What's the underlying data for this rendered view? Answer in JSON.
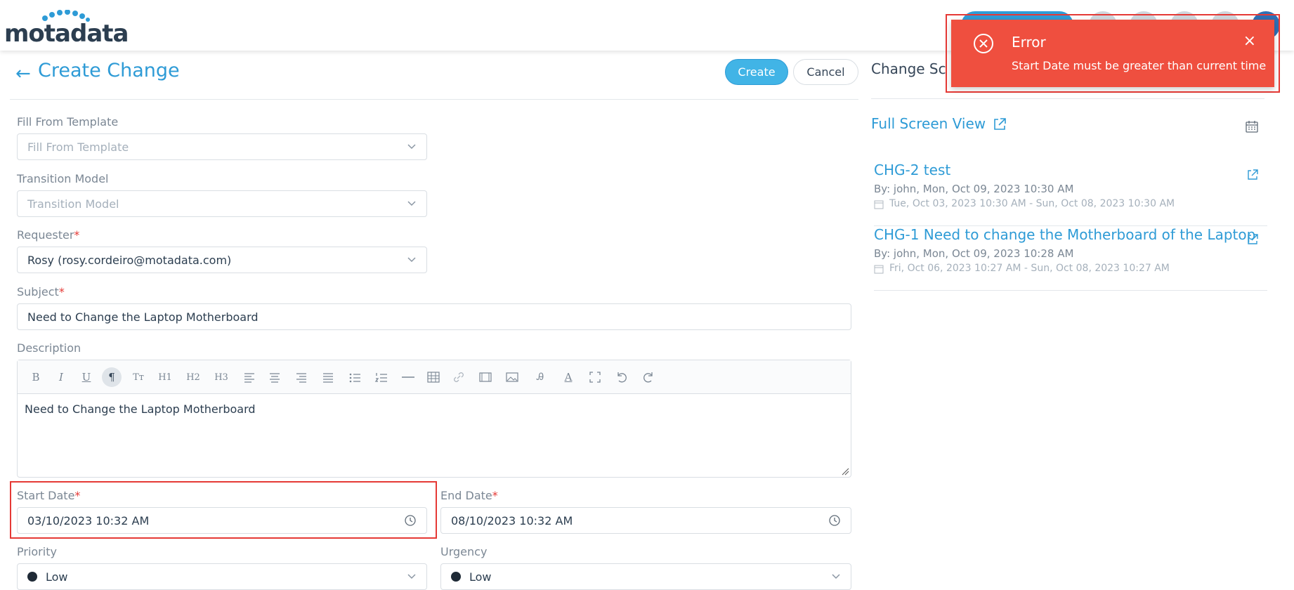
{
  "brand": {
    "logo_text": "motadata"
  },
  "header": {
    "title": "Create Change",
    "create_label": "Create",
    "cancel_label": "Cancel"
  },
  "form": {
    "template": {
      "label": "Fill From Template",
      "placeholder": "Fill From Template"
    },
    "transition_model": {
      "label": "Transition Model",
      "placeholder": "Transition Model"
    },
    "requester": {
      "label": "Requester",
      "required_mark": "*",
      "value": "Rosy (rosy.cordeiro@motadata.com)"
    },
    "subject": {
      "label": "Subject",
      "required_mark": "*",
      "value": "Need to Change the Laptop Motherboard"
    },
    "description": {
      "label": "Description",
      "value": "Need to Change the Laptop Motherboard",
      "toolbar": [
        "B",
        "I",
        "U",
        "¶",
        "Tт",
        "H1",
        "H2",
        "H3"
      ]
    },
    "start_date": {
      "label": "Start Date",
      "required_mark": "*",
      "value": "03/10/2023 10:32 AM"
    },
    "end_date": {
      "label": "End Date",
      "required_mark": "*",
      "value": "08/10/2023 10:32 AM"
    },
    "priority": {
      "label": "Priority",
      "value": "Low"
    },
    "urgency": {
      "label": "Urgency",
      "value": "Low"
    }
  },
  "schedule": {
    "title": "Change Sc",
    "full_screen_label": "Full Screen View",
    "items": [
      {
        "title": "CHG-2 test",
        "by": "By: john, Mon, Oct 09, 2023 10:30 AM",
        "range": "Tue, Oct 03, 2023 10:30 AM - Sun, Oct 08, 2023 10:30 AM"
      },
      {
        "title": "CHG-1 Need to change the Motherboard of the Laptop",
        "by": "By: john, Mon, Oct 09, 2023 10:28 AM",
        "range": "Fri, Oct 06, 2023 10:27 AM - Sun, Oct 08, 2023 10:27 AM"
      }
    ]
  },
  "toast": {
    "title": "Error",
    "message": "Start Date must be greater than current time"
  },
  "colors": {
    "accent": "#2e9bd6",
    "error": "#ef4f3f",
    "highlight": "#e53935"
  }
}
